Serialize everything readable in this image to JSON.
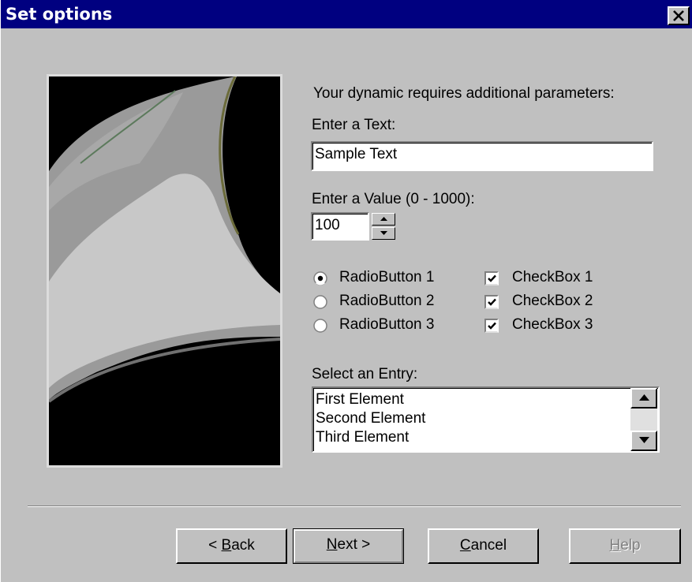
{
  "window": {
    "title": "Set options",
    "close_glyph": "✕"
  },
  "prompt": "Your dynamic requires additional parameters:",
  "text_field": {
    "label": "Enter a Text:",
    "value": "Sample Text"
  },
  "value_field": {
    "label": "Enter a Value (0 - 1000):",
    "value": "100"
  },
  "radios": [
    {
      "label": "RadioButton 1",
      "checked": true
    },
    {
      "label": "RadioButton 2",
      "checked": false
    },
    {
      "label": "RadioButton 3",
      "checked": false
    }
  ],
  "checkboxes": [
    {
      "label": "CheckBox 1",
      "checked": true
    },
    {
      "label": "CheckBox 2",
      "checked": true
    },
    {
      "label": "CheckBox 3",
      "checked": true
    }
  ],
  "list": {
    "label": "Select an Entry:",
    "items": [
      "First Element",
      "Second Element",
      "Third Element"
    ]
  },
  "buttons": {
    "back": {
      "prefix": "< ",
      "mnemonic": "B",
      "rest": "ack"
    },
    "next": {
      "mnemonic": "N",
      "rest": "ext >"
    },
    "cancel": {
      "mnemonic": "C",
      "rest": "ancel"
    },
    "help": {
      "mnemonic": "H",
      "rest": "elp"
    }
  },
  "colors": {
    "titlebar": "#000080",
    "face": "#c0c0c0"
  },
  "icons": [
    "close-icon",
    "spin-up-icon",
    "spin-down-icon",
    "scroll-up-icon",
    "scroll-down-icon"
  ]
}
